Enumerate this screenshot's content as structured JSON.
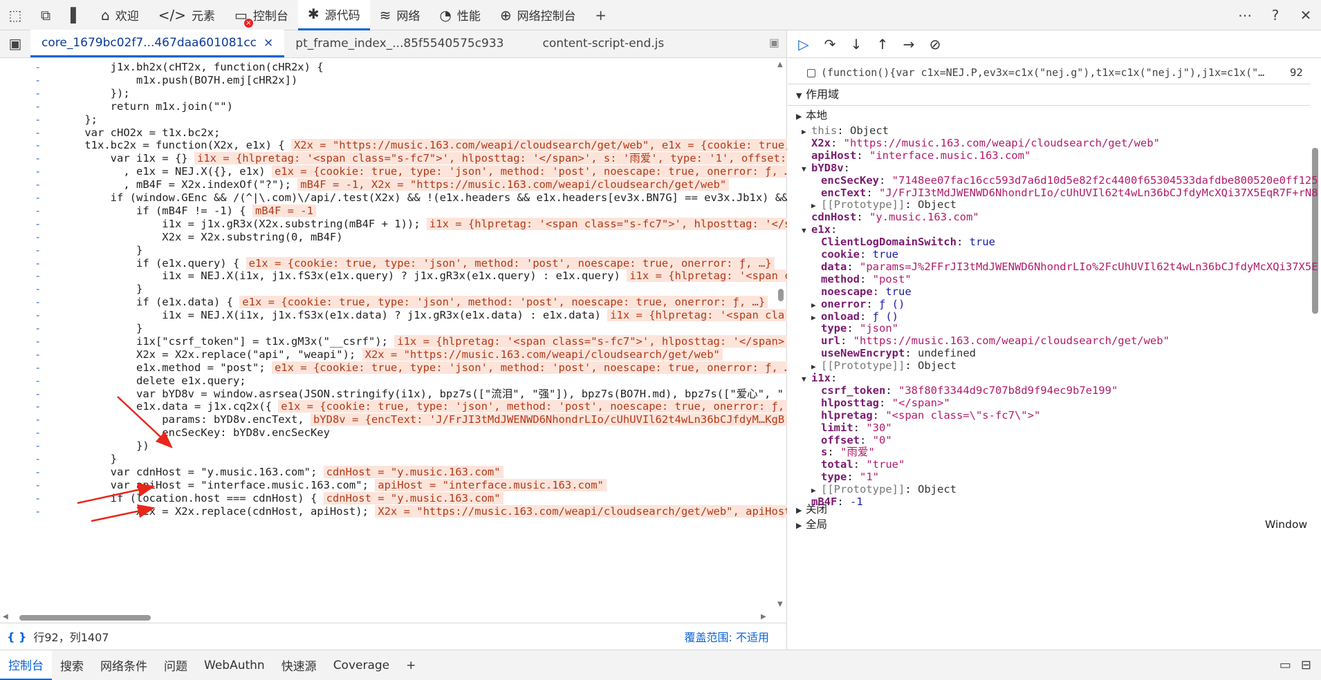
{
  "toolbar": {
    "tabs": [
      {
        "label": "欢迎",
        "icon": "home-icon"
      },
      {
        "label": "元素",
        "icon": "code-icon"
      },
      {
        "label": "控制台",
        "icon": "console-icon"
      },
      {
        "label": "源代码",
        "icon": "bug-icon"
      },
      {
        "label": "网络",
        "icon": "wifi-icon"
      },
      {
        "label": "性能",
        "icon": "gauge-icon"
      },
      {
        "label": "网络控制台",
        "icon": "globe-icon"
      }
    ],
    "active": "源代码",
    "console_error_badge": "×"
  },
  "files": {
    "tabs": [
      "core_1679bc02f7...467daa601081cc",
      "pt_frame_index_...85f5540575c933",
      "content-script-end.js"
    ],
    "close": "×"
  },
  "code": {
    "lines": [
      {
        "t": "        j1x.bh2x(cHT2x, function(cHR2x) {",
        "a": ""
      },
      {
        "t": "            m1x.push(BO7H.emj[cHR2x])",
        "a": ""
      },
      {
        "t": "        });",
        "a": ""
      },
      {
        "t": "        return m1x.join(\"\")",
        "a": ""
      },
      {
        "t": "    };",
        "a": ""
      },
      {
        "t": "    var cHO2x = t1x.bc2x;",
        "a": ""
      },
      {
        "t": "    t1x.bc2x = function(X2x, e1x) { ",
        "a": "X2x = \"https://music.163.com/weapi/cloudsearch/get/web\", e1x = {cookie: true,"
      },
      {
        "t": "        var i1x = {} ",
        "a": "i1x = {hlpretag: '<span class=\"s-fc7\">', hlposttag: '</span>', s: '雨爱', type: '1', offset:"
      },
      {
        "t": "          , e1x = NEJ.X({}, e1x) ",
        "a": "e1x = {cookie: true, type: 'json', method: 'post', noescape: true, onerror: ƒ, …"
      },
      {
        "t": "          , mB4F = X2x.indexOf(\"?\"); ",
        "a": "mB4F = -1, X2x = \"https://music.163.com/weapi/cloudsearch/get/web\""
      },
      {
        "t": "        if (window.GEnc && /(^|\\.com)\\/api/.test(X2x) && !(e1x.headers && e1x.headers[ev3x.BN7G] == ev3x.Jb1x) &&",
        "a": ""
      },
      {
        "t": "            if (mB4F != -1) { ",
        "a": "mB4F = -1"
      },
      {
        "t": "                i1x = j1x.gR3x(X2x.substring(mB4F + 1)); ",
        "a": "i1x = {hlpretag: '<span class=\"s-fc7\">', hlposttag: '</s"
      },
      {
        "t": "                X2x = X2x.substring(0, mB4F)",
        "a": ""
      },
      {
        "t": "            }",
        "a": ""
      },
      {
        "t": "            if (e1x.query) { ",
        "a": "e1x = {cookie: true, type: 'json', method: 'post', noescape: true, onerror: ƒ, …}"
      },
      {
        "t": "                i1x = NEJ.X(i1x, j1x.fS3x(e1x.query) ? j1x.gR3x(e1x.query) : e1x.query) ",
        "a": "i1x = {hlpretag: '<span c"
      },
      {
        "t": "            }",
        "a": ""
      },
      {
        "t": "            if (e1x.data) { ",
        "a": "e1x = {cookie: true, type: 'json', method: 'post', noescape: true, onerror: ƒ, …}"
      },
      {
        "t": "                i1x = NEJ.X(i1x, j1x.fS3x(e1x.data) ? j1x.gR3x(e1x.data) : e1x.data) ",
        "a": "i1x = {hlpretag: '<span cla"
      },
      {
        "t": "            }",
        "a": ""
      },
      {
        "t": "            i1x[\"csrf_token\"] = t1x.gM3x(\"__csrf\"); ",
        "a": "i1x = {hlpretag: '<span class=\"s-fc7\">', hlposttag: '</span>"
      },
      {
        "t": "            X2x = X2x.replace(\"api\", \"weapi\"); ",
        "a": "X2x = \"https://music.163.com/weapi/cloudsearch/get/web\""
      },
      {
        "t": "            e1x.method = \"post\"; ",
        "a": "e1x = {cookie: true, type: 'json', method: 'post', noescape: true, onerror: ƒ, …"
      },
      {
        "t": "            delete e1x.query;",
        "a": ""
      },
      {
        "t": "            var bYD8v = window.asrsea(JSON.stringify(i1x), bpz7s([\"流泪\", \"强\"]), bpz7s(BO7H.md), bpz7s([\"爱心\", \"",
        "a": ""
      },
      {
        "t": "            e1x.data = j1x.cq2x({ ",
        "a": "e1x = {cookie: true, type: 'json', method: 'post', noescape: true, onerror: ƒ,"
      },
      {
        "t": "                params: bYD8v.encText, ",
        "a": "bYD8v = {encText: 'J/FrJI3tMdJWENWD6NhondrLIo/cUhUVIl62t4wLn36bCJfdyM…KgB:"
      },
      {
        "t": "                encSecKey: bYD8v.encSecKey",
        "a": ""
      },
      {
        "t": "            })",
        "a": ""
      },
      {
        "t": "        }",
        "a": ""
      },
      {
        "t": "        var cdnHost = \"y.music.163.com\"; ",
        "a": "cdnHost = \"y.music.163.com\""
      },
      {
        "t": "        var apiHost = \"interface.music.163.com\"; ",
        "a": "apiHost = \"interface.music.163.com\""
      },
      {
        "t": "        if (location.host === cdnHost) { ",
        "a": "cdnHost = \"y.music.163.com\""
      },
      {
        "t": "            X2x = X2x.replace(cdnHost, apiHost); ",
        "a": "X2x = \"https://music.163.com/weapi/cloudsearch/get/web\", apiHost"
      }
    ]
  },
  "status": {
    "position": "行92，列1407",
    "coverage": "覆盖范围: 不适用"
  },
  "breakpoint": {
    "text": "(function(){var c1x=NEJ.P,ev3x=c1x(\"nej.g\"),t1x=c1x(\"nej.j\"),j1x=c1x(\"…",
    "line": "92"
  },
  "scope": {
    "title": "作用域",
    "local": "本地",
    "closure": "关闭",
    "global": "全局",
    "global_value": "Window",
    "rows": [
      {
        "d": 1,
        "tri": "▶",
        "k": "this",
        "v": "Object",
        "c": "obj",
        "dim": true
      },
      {
        "d": 1,
        "tri": "",
        "k": "X2x",
        "v": "\"https://music.163.com/weapi/cloudsearch/get/web\"",
        "c": "str"
      },
      {
        "d": 1,
        "tri": "",
        "k": "apiHost",
        "v": "\"interface.music.163.com\"",
        "c": "str"
      },
      {
        "d": 1,
        "tri": "▼",
        "k": "bYD8v",
        "v": "",
        "c": "obj"
      },
      {
        "d": 2,
        "tri": "",
        "k": "encSecKey",
        "v": "\"7148ee07fac16cc593d7a6d10d5e82f2c4400f65304533dafdbe800520e0ff125",
        "c": "str"
      },
      {
        "d": 2,
        "tri": "",
        "k": "encText",
        "v": "\"J/FrJI3tMdJWENWD6NhondrLIo/cUhUVIl62t4wLn36bCJfdyMcXQi37X5EqR7F+rN8",
        "c": "str"
      },
      {
        "d": 2,
        "tri": "▶",
        "k": "[[Prototype]]",
        "v": "Object",
        "c": "obj",
        "dim": true
      },
      {
        "d": 1,
        "tri": "",
        "k": "cdnHost",
        "v": "\"y.music.163.com\"",
        "c": "str"
      },
      {
        "d": 1,
        "tri": "▼",
        "k": "e1x",
        "v": "",
        "c": "obj"
      },
      {
        "d": 2,
        "tri": "",
        "k": "ClientLogDomainSwitch",
        "v": "true",
        "c": "kw"
      },
      {
        "d": 2,
        "tri": "",
        "k": "cookie",
        "v": "true",
        "c": "kw"
      },
      {
        "d": 2,
        "tri": "",
        "k": "data",
        "v": "\"params=J%2FFrJI3tMdJWENWD6NhondrLIo%2FcUhUVIl62t4wLn36bCJfdyMcXQi37X5E",
        "c": "str"
      },
      {
        "d": 2,
        "tri": "",
        "k": "method",
        "v": "\"post\"",
        "c": "str"
      },
      {
        "d": 2,
        "tri": "",
        "k": "noescape",
        "v": "true",
        "c": "kw"
      },
      {
        "d": 2,
        "tri": "▶",
        "k": "onerror",
        "v": "ƒ ()",
        "c": "kw"
      },
      {
        "d": 2,
        "tri": "▶",
        "k": "onload",
        "v": "ƒ ()",
        "c": "kw"
      },
      {
        "d": 2,
        "tri": "",
        "k": "type",
        "v": "\"json\"",
        "c": "str"
      },
      {
        "d": 2,
        "tri": "",
        "k": "url",
        "v": "\"https://music.163.com/weapi/cloudsearch/get/web\"",
        "c": "str"
      },
      {
        "d": 2,
        "tri": "",
        "k": "useNewEncrypt",
        "v": "undefined",
        "c": "obj"
      },
      {
        "d": 2,
        "tri": "▶",
        "k": "[[Prototype]]",
        "v": "Object",
        "c": "obj",
        "dim": true
      },
      {
        "d": 1,
        "tri": "▼",
        "k": "i1x",
        "v": "",
        "c": "obj"
      },
      {
        "d": 2,
        "tri": "",
        "k": "csrf_token",
        "v": "\"38f80f3344d9c707b8d9f94ec9b7e199\"",
        "c": "str"
      },
      {
        "d": 2,
        "tri": "",
        "k": "hlposttag",
        "v": "\"</span>\"",
        "c": "str"
      },
      {
        "d": 2,
        "tri": "",
        "k": "hlpretag",
        "v": "\"<span class=\\\"s-fc7\\\">\"",
        "c": "str"
      },
      {
        "d": 2,
        "tri": "",
        "k": "limit",
        "v": "\"30\"",
        "c": "str"
      },
      {
        "d": 2,
        "tri": "",
        "k": "offset",
        "v": "\"0\"",
        "c": "str"
      },
      {
        "d": 2,
        "tri": "",
        "k": "s",
        "v": "\"雨爱\"",
        "c": "str"
      },
      {
        "d": 2,
        "tri": "",
        "k": "total",
        "v": "\"true\"",
        "c": "str"
      },
      {
        "d": 2,
        "tri": "",
        "k": "type",
        "v": "\"1\"",
        "c": "str"
      },
      {
        "d": 2,
        "tri": "▶",
        "k": "[[Prototype]]",
        "v": "Object",
        "c": "obj",
        "dim": true
      },
      {
        "d": 1,
        "tri": "",
        "k": "mB4F",
        "v": "-1",
        "c": "num"
      }
    ]
  },
  "bottom": {
    "tabs": [
      "控制台",
      "搜索",
      "网络条件",
      "问题",
      "WebAuthn",
      "快速源",
      "Coverage"
    ],
    "active": "控制台"
  },
  "gutter_mark": "-"
}
